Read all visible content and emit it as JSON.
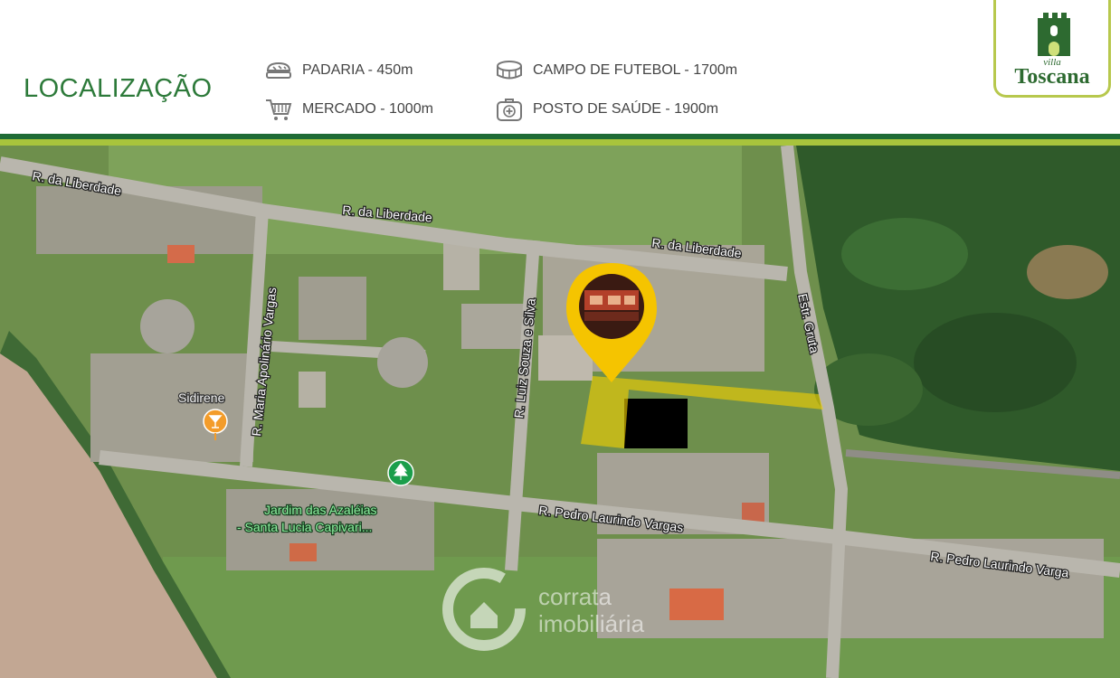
{
  "header": {
    "title": "LOCALIZAÇÃO",
    "pois": [
      {
        "label": "PADARIA - 450m",
        "icon": "bread-icon"
      },
      {
        "label": "MERCADO - 1000m",
        "icon": "cart-icon"
      },
      {
        "label": "CAMPO DE FUTEBOL - 1700m",
        "icon": "stadium-icon"
      },
      {
        "label": "POSTO DE SAÚDE - 1900m",
        "icon": "medical-kit-icon"
      }
    ]
  },
  "logo": {
    "line1": "villa",
    "line2": "Toscana"
  },
  "colors": {
    "brand_green": "#2d7a3a",
    "band_dark": "#1f6b35",
    "band_light": "#a8c43c",
    "highlight_yellow": "#f2d000"
  },
  "map": {
    "streets": [
      "R. da Liberdade",
      "R. da Liberdade",
      "R. da Liberdade",
      "R. Maria Apolinário Vargas",
      "R. Luiz Souza e Silva",
      "Estr. Gruta",
      "R. Pedro Laurindo Vargas",
      "R. Pedro Laurindo Varga"
    ],
    "places": [
      {
        "name": "Sidirene",
        "icon": "cocktail-icon"
      },
      {
        "name": "Jardim das Azaléias",
        "name2": "- Santa Lucia Capivari...",
        "icon": "tree-icon"
      }
    ],
    "watermark": {
      "line1": "corrata",
      "line2": "imobiliária"
    }
  }
}
